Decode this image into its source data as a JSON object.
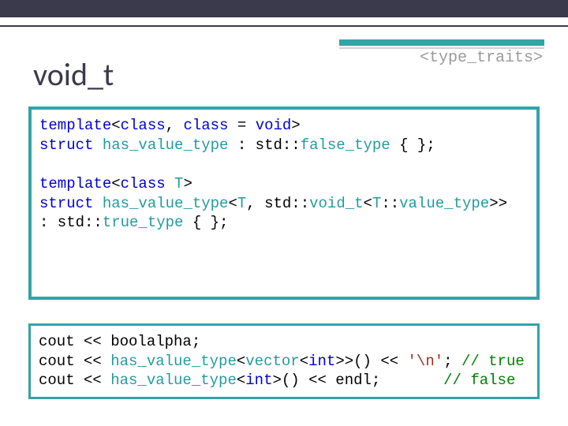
{
  "header": {
    "library": "<type_traits>"
  },
  "title": "void_t",
  "code1": {
    "l1a": "template",
    "l1b": "<",
    "l1c": "class",
    "l1d": ", ",
    "l1e": "class",
    "l1f": " = ",
    "l1g": "void",
    "l1h": ">",
    "l2a": "struct",
    "l2b": " ",
    "l2c": "has_value_type",
    "l2d": " : std::",
    "l2e": "false_type",
    "l2f": " { };",
    "blank": "",
    "l4a": "template",
    "l4b": "<",
    "l4c": "class",
    "l4d": " ",
    "l4e": "T",
    "l4f": ">",
    "l5a": "struct",
    "l5b": " ",
    "l5c": "has_value_type",
    "l5d": "<",
    "l5e": "T",
    "l5f": ", std::",
    "l5g": "void_t",
    "l5h": "<",
    "l5i": "T",
    "l5j": "::",
    "l5k": "value_type",
    "l5l": ">>",
    "l6a": ": std::",
    "l6b": "true_type",
    "l6c": " { };"
  },
  "code2": {
    "l1": "cout << boolalpha;",
    "l2a": "cout << ",
    "l2b": "has_value_type",
    "l2c": "<",
    "l2d": "vector",
    "l2e": "<",
    "l2f": "int",
    "l2g": ">>() << ",
    "l2h": "'\\n'",
    "l2i": "; ",
    "l2j": "// true",
    "l3a": "cout << ",
    "l3b": "has_value_type",
    "l3c": "<",
    "l3d": "int",
    "l3e": ">() << endl;       ",
    "l3f": "// false"
  }
}
